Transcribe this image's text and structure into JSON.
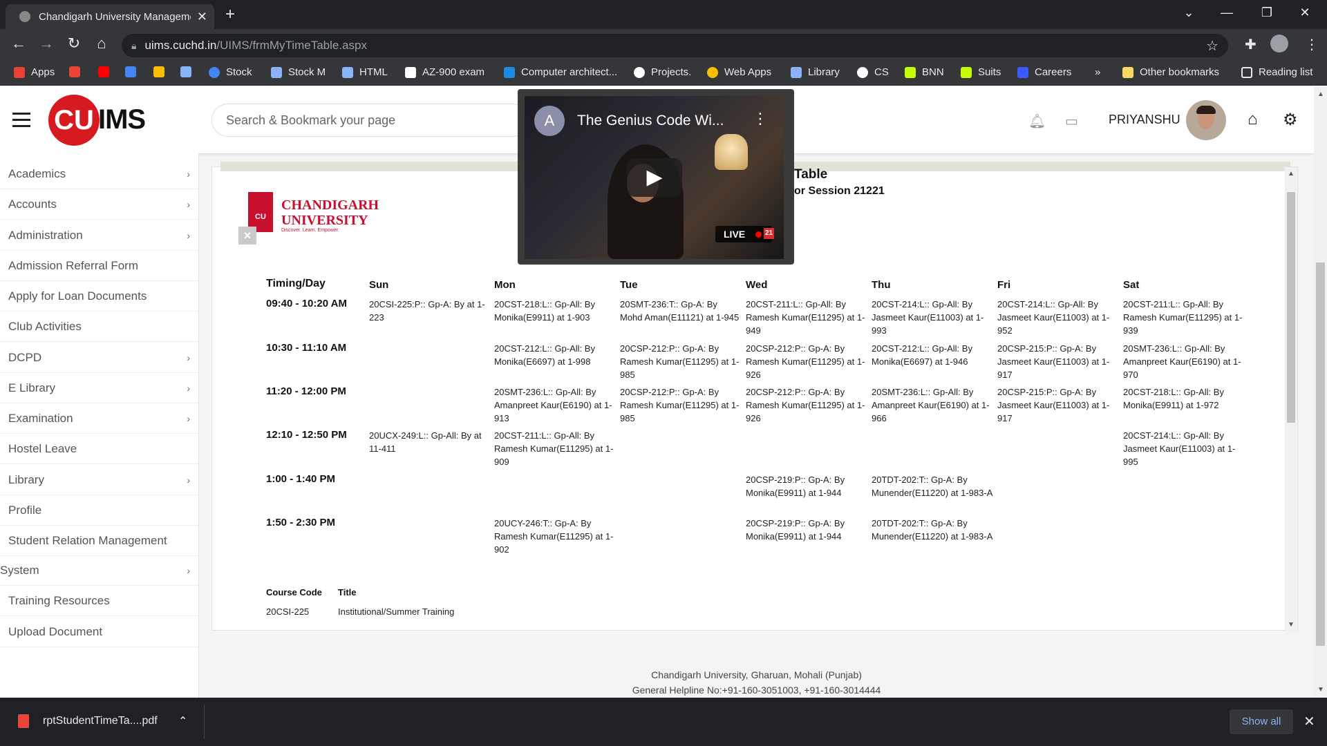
{
  "browser": {
    "tab_title": "Chandigarh University Management",
    "new_tab": "+",
    "url_host": "uims.cuchd.in",
    "url_path": "/UIMS/frmMyTimeTable.aspx",
    "bookmarks": [
      {
        "label": "Apps",
        "color": "#e94235"
      },
      {
        "label": "",
        "color": "#ea4335"
      },
      {
        "label": "",
        "color": "#ff0000"
      },
      {
        "label": "",
        "color": "#4285f4"
      },
      {
        "label": "",
        "color": "#fbbc04"
      },
      {
        "label": "",
        "color": "#8ab4f8"
      },
      {
        "label": "Stock",
        "color": "#4285f4"
      },
      {
        "label": "Stock M",
        "color": "#8ab4f8"
      },
      {
        "label": "HTML",
        "color": "#8ab4f8"
      },
      {
        "label": "AZ-900 exam",
        "color": "#ffffff"
      },
      {
        "label": "Computer architect...",
        "color": "#1e88e5"
      },
      {
        "label": "Projects.",
        "color": "#ffffff"
      },
      {
        "label": "Web Apps",
        "color": "#fbbc04"
      },
      {
        "label": "Library",
        "color": "#8ab4f8"
      },
      {
        "label": "CS",
        "color": "#ffffff"
      },
      {
        "label": "BNN",
        "color": "#c6ff00"
      },
      {
        "label": "Suits",
        "color": "#c6ff00"
      },
      {
        "label": "Careers",
        "color": "#3d5afe"
      },
      {
        "label": "»",
        "color": ""
      },
      {
        "label": "Other bookmarks",
        "color": "#fdd663"
      },
      {
        "label": "Reading list",
        "color": "#e8eaed"
      }
    ]
  },
  "header": {
    "logo_cu": "CU",
    "logo_ims": "IMS",
    "search_placeholder": "Search & Bookmark your page",
    "username": "PRIYANSHU"
  },
  "sidebar": {
    "items": [
      {
        "label": "Academics",
        "chevron": "›"
      },
      {
        "label": "Accounts",
        "chevron": "›"
      },
      {
        "label": "Administration",
        "chevron": "›"
      },
      {
        "label": "Admission Referral Form",
        "chevron": ""
      },
      {
        "label": "Apply for Loan Documents",
        "chevron": ""
      },
      {
        "label": "Club Activities",
        "chevron": ""
      },
      {
        "label": "DCPD",
        "chevron": "›"
      },
      {
        "label": "E Library",
        "chevron": "›"
      },
      {
        "label": "Examination",
        "chevron": "›"
      },
      {
        "label": "Hostel Leave",
        "chevron": ""
      },
      {
        "label": "Library",
        "chevron": "›"
      },
      {
        "label": "Profile",
        "chevron": ""
      },
      {
        "label": "Student Relation Management",
        "chevron": ""
      },
      {
        "label": "System",
        "chevron": "›"
      },
      {
        "label": "Training Resources",
        "chevron": ""
      },
      {
        "label": "Upload Document",
        "chevron": ""
      }
    ]
  },
  "report": {
    "university_line1": "CHANDIGARH",
    "university_line2": "UNIVERSITY",
    "university_slogan": "Discover. Learn. Empower.",
    "seal_text": "CU",
    "close_glyph": "×",
    "title_partial": "Table",
    "session_partial": "or Session 21221",
    "headers": [
      "Timing/Day",
      "Sun",
      "Mon",
      "Tue",
      "Wed",
      "Thu",
      "Fri",
      "Sat"
    ],
    "rows": [
      {
        "time": "09:40 - 10:20 AM",
        "cells": [
          "20CSI-225:P:: Gp-A: By  at 1-223",
          "20CST-218:L:: Gp-All: By Monika(E9911) at 1-903",
          "20SMT-236:T:: Gp-A: By Mohd Aman(E11121) at 1-945",
          "20CST-211:L:: Gp-All: By Ramesh Kumar(E11295) at 1-949",
          "20CST-214:L:: Gp-All: By Jasmeet Kaur(E11003) at 1-993",
          "20CST-214:L:: Gp-All: By Jasmeet Kaur(E11003) at 1-952",
          "20CST-211:L:: Gp-All: By Ramesh Kumar(E11295) at 1-939"
        ]
      },
      {
        "time": "10:30 - 11:10 AM",
        "cells": [
          "",
          "20CST-212:L:: Gp-All: By Monika(E6697) at 1-998",
          "20CSP-212:P:: Gp-A: By Ramesh Kumar(E11295) at 1-985",
          "20CSP-212:P:: Gp-A: By Ramesh Kumar(E11295) at 1-926",
          "20CST-212:L:: Gp-All: By Monika(E6697) at 1-946",
          "20CSP-215:P:: Gp-A: By Jasmeet Kaur(E11003) at 1-917",
          "20SMT-236:L:: Gp-All: By Amanpreet Kaur(E6190) at 1-970"
        ]
      },
      {
        "time": "11:20 - 12:00 PM",
        "cells": [
          "",
          "20SMT-236:L:: Gp-All: By Amanpreet Kaur(E6190) at 1-913",
          "20CSP-212:P:: Gp-A: By Ramesh Kumar(E11295) at 1-985",
          "20CSP-212:P:: Gp-A: By Ramesh Kumar(E11295) at 1-926",
          "20SMT-236:L:: Gp-All: By Amanpreet Kaur(E6190) at 1-966",
          "20CSP-215:P:: Gp-A: By Jasmeet Kaur(E11003) at 1-917",
          "20CST-218:L:: Gp-All: By Monika(E9911) at 1-972"
        ]
      },
      {
        "time": "12:10 - 12:50 PM",
        "cells": [
          "20UCX-249:L:: Gp-All: By  at 11-411",
          "20CST-211:L:: Gp-All: By Ramesh Kumar(E11295) at 1-909",
          "",
          "",
          "",
          "",
          "20CST-214:L:: Gp-All: By Jasmeet Kaur(E11003) at 1-995"
        ]
      },
      {
        "time": "1:00 - 1:40 PM",
        "cells": [
          "",
          "",
          "",
          "20CSP-219:P:: Gp-A: By Monika(E9911) at 1-944",
          "20TDT-202:T:: Gp-A: By Munender(E11220) at 1-983-A",
          "",
          ""
        ]
      },
      {
        "time": "1:50 - 2:30 PM",
        "cells": [
          "",
          "20UCY-246:T:: Gp-A: By Ramesh Kumar(E11295) at 1-902",
          "",
          "20CSP-219:P:: Gp-A: By Monika(E9911) at 1-944",
          "20TDT-202:T:: Gp-A: By Munender(E11220) at 1-983-A",
          "",
          ""
        ]
      }
    ],
    "course_code_header": "Course Code",
    "title_header": "Title",
    "course_code": "20CSI-225",
    "course_title": "Institutional/Summer Training"
  },
  "footer": {
    "line1": "Chandigarh University, Gharuan, Mohali (Punjab)",
    "line2": "General Helpline No:+91-160-3051003, +91-160-3014444"
  },
  "pip": {
    "channel_initial": "A",
    "video_title": "The Genius Code Wi...",
    "live_label": "LIVE",
    "live_badge": "21"
  },
  "downloads": {
    "file_name": "rptStudentTimeTa....pdf",
    "show_all": "Show all"
  }
}
